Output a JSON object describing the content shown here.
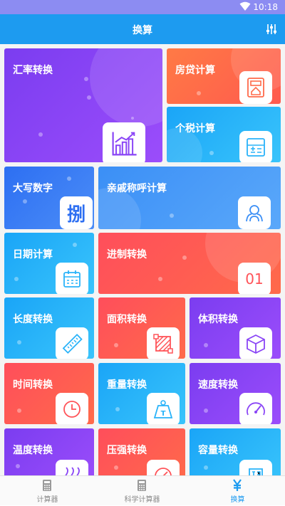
{
  "status": {
    "time": "10:18"
  },
  "appbar": {
    "title": "换算"
  },
  "tiles": {
    "exchange": "汇率转换",
    "mortgage": "房贷计算",
    "tax": "个税计算",
    "uppercase": "大写数字",
    "relative": "亲戚称呼计算",
    "date": "日期计算",
    "base": "进制转换",
    "length": "长度转换",
    "area": "面积转换",
    "volume": "体积转换",
    "time": "时间转换",
    "weight": "重量转换",
    "speed": "速度转换",
    "temperature": "温度转换",
    "pressure": "压强转换",
    "capacity": "容量转换"
  },
  "icons": {
    "uppercase_char": "捌",
    "base_text": "01",
    "weight_char": "T"
  },
  "tabs": [
    {
      "label": "计算器",
      "icon": "calculator-icon"
    },
    {
      "label": "科学计算器",
      "icon": "scientific-calculator-icon"
    },
    {
      "label": "换算",
      "icon": "yuan-icon"
    }
  ],
  "colors": {
    "appbar": "#1d9bf0",
    "status_bar": "#8c8cf2",
    "purple": "#8a45f6",
    "orange": "#ff6a4a",
    "blue": "#29b3f9",
    "red": "#ff5358",
    "active_tab": "#1d9bf0"
  }
}
